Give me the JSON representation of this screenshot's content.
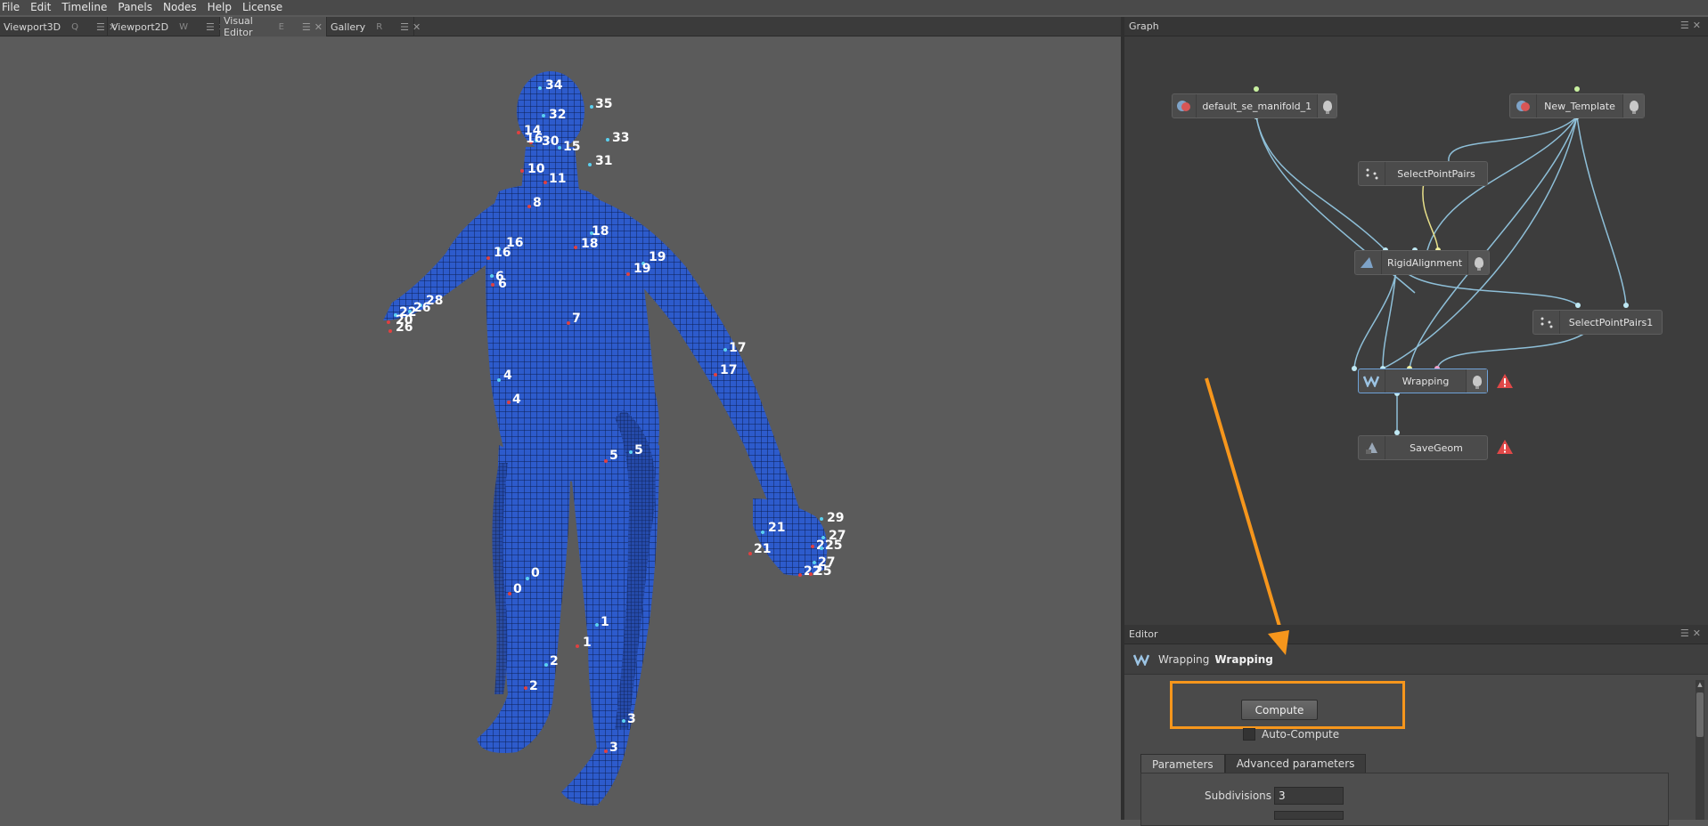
{
  "menu": [
    "File",
    "Edit",
    "Timeline",
    "Panels",
    "Nodes",
    "Help",
    "License"
  ],
  "tabs": [
    {
      "label": "Viewport3D",
      "key": "Q"
    },
    {
      "label": "Viewport2D",
      "key": "W"
    },
    {
      "label": "Visual Editor",
      "key": "E"
    },
    {
      "label": "Gallery",
      "key": "R"
    }
  ],
  "tab_controls": {
    "menu": "☰",
    "close": "✕"
  },
  "viewport": {
    "mesh_color": "#2f5fd1",
    "point_labels": [
      "34",
      "35",
      "32",
      "33",
      "14",
      "30",
      "16",
      "15",
      "10",
      "11",
      "31",
      "8",
      "16",
      "16",
      "18",
      "18",
      "19",
      "19",
      "6",
      "6",
      "28",
      "26",
      "22",
      "20",
      "26",
      "7",
      "4",
      "4",
      "17",
      "17",
      "5",
      "5",
      "0",
      "0",
      "1",
      "1",
      "2",
      "2",
      "3",
      "3",
      "21",
      "21",
      "29",
      "27",
      "22",
      "25",
      "27",
      "22",
      "25"
    ]
  },
  "graph": {
    "title": "Graph",
    "nodes": {
      "n1": "default_se_manifold_1",
      "n2": "New_Template",
      "n3": "SelectPointPairs",
      "n4": "RigidAlignment",
      "n5": "SelectPointPairs1",
      "n6": "Wrapping",
      "n7": "SaveGeom"
    },
    "warning_icon": "warning-triangle-icon",
    "wire_color": "#8ebfd8"
  },
  "editor": {
    "title": "Editor",
    "node_type": "Wrapping",
    "node_name": "Wrapping",
    "compute_label": "Compute",
    "auto_compute_label": "Auto-Compute",
    "tabs": [
      "Parameters",
      "Advanced parameters"
    ],
    "subdivisions_label": "Subdivisions",
    "subdivisions_value": "3"
  },
  "annotation": {
    "color": "#f6961c"
  }
}
